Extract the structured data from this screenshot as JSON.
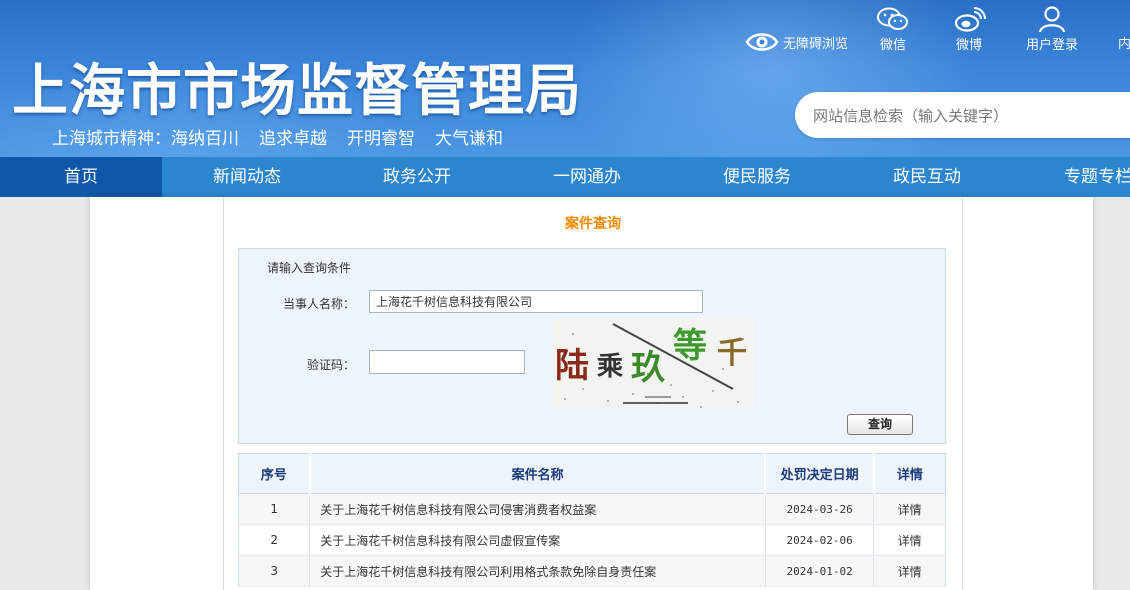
{
  "header": {
    "site_title": "上海市市场监督管理局",
    "slogan_lead": "上海城市精神：",
    "slogan_items": [
      "海纳百川",
      "追求卓越",
      "开明睿智",
      "大气谦和"
    ],
    "accessibility_label": "无障碍浏览",
    "tools": {
      "wechat": "微信",
      "weibo": "微博",
      "login": "用户登录",
      "more": "内"
    },
    "search_placeholder": "网站信息检索（输入关键字）"
  },
  "nav": {
    "items": [
      "首页",
      "新闻动态",
      "政务公开",
      "一网通办",
      "便民服务",
      "政民互动",
      "专题专栏"
    ],
    "active_index": 0
  },
  "query": {
    "title": "案件查询",
    "hint": "请输入查询条件",
    "party_label": "当事人名称：",
    "party_value": "上海花千树信息科技有限公司",
    "captcha_label": "验证码：",
    "captcha_value": "",
    "captcha_chars": [
      "陆",
      "乘",
      "玖",
      "等",
      "千"
    ],
    "submit_label": "查询"
  },
  "results": {
    "columns": [
      "序号",
      "案件名称",
      "处罚决定日期",
      "详情"
    ],
    "rows": [
      {
        "no": "1",
        "name": "关于上海花千树信息科技有限公司侵害消费者权益案",
        "date": "2024-03-26",
        "detail": "详情"
      },
      {
        "no": "2",
        "name": "关于上海花千树信息科技有限公司虚假宣传案",
        "date": "2024-02-06",
        "detail": "详情"
      },
      {
        "no": "3",
        "name": "关于上海花千树信息科技有限公司利用格式条款免除自身责任案",
        "date": "2024-01-02",
        "detail": "详情"
      }
    ]
  },
  "colors": {
    "header_blue": "#3b86da",
    "nav_blue": "#2c85cf",
    "nav_active": "#0d58a8",
    "title_orange": "#f08a00",
    "table_header_text": "#1e3c7a"
  }
}
